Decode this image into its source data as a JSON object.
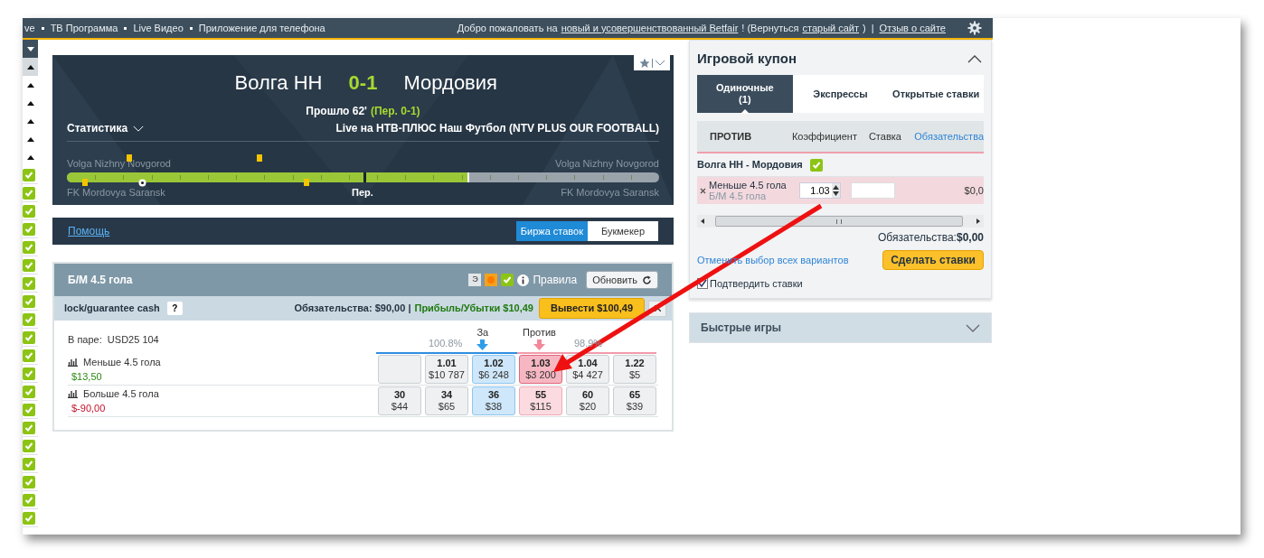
{
  "top_nav": {
    "links": [
      "ve",
      "ТВ Программа",
      "Live Видео",
      "Приложение для телефона"
    ],
    "welcome": "Добро пожаловать на",
    "new_site_link": "новый и усовершенствованный Betfair",
    "welcome_end": "! (Вернуться",
    "old_site_link": "старый сайт",
    "close_paren": ")",
    "separator": "|",
    "feedback_link": "Отзыв о сайте"
  },
  "left_column": {
    "checks": [
      {
        "checked": true
      },
      {
        "checked": true
      },
      {
        "checked": true
      },
      {
        "checked": true
      },
      {
        "checked": true
      },
      {
        "checked": true
      },
      {
        "checked": true
      },
      {
        "checked": true
      },
      {
        "checked": true
      },
      {
        "checked": true
      },
      {
        "checked": true
      },
      {
        "checked": true
      },
      {
        "checked": true
      },
      {
        "checked": true
      },
      {
        "checked": true
      },
      {
        "checked": true
      },
      {
        "checked": true
      },
      {
        "checked": true
      },
      {
        "checked": true
      },
      {
        "checked": true
      }
    ]
  },
  "scoreboard": {
    "home": "Волга НН",
    "score": "0-1",
    "away": "Мордовия",
    "elapsed": "Прошло 62'",
    "half_score": "(Пер. 0-1)",
    "stats_label": "Статистика",
    "broadcast": "Live на НТВ-ПЛЮС Наш Футбол (NTV PLUS OUR FOOTBALL)",
    "timeline": {
      "home_left": "Volga Nizhny Novgorod",
      "home_right": "Volga Nizhny Novgorod",
      "away_left": "FK Mordovya Saransk",
      "away_right": "FK Mordovya Saransk",
      "halftime": "Пер.",
      "level": 0.68,
      "home_events": [
        {
          "kind": "card",
          "level": 0.1
        },
        {
          "kind": "card",
          "level": 0.32
        }
      ],
      "away_events": [
        {
          "kind": "card",
          "level": 0.026
        },
        {
          "kind": "goal",
          "level": 0.12
        },
        {
          "kind": "card",
          "level": 0.4
        }
      ]
    }
  },
  "help_bar": {
    "help_link": "Помощь",
    "modes": [
      {
        "label": "Биржа ставок",
        "selected": true
      },
      {
        "label": "Букмекер",
        "selected": false
      }
    ]
  },
  "market": {
    "title": "Б/М 4.5 гола",
    "e_badge": "Э",
    "rules": "Правила",
    "refresh": "Обновить",
    "cashout_label": "lock/guarantee cash",
    "help": "?",
    "liability": "Обязательства: $90,00 |",
    "profit": "Прибыль/Убытки $10,49",
    "cashout_button": "Вывести $100,49",
    "matched": "В паре:  USD25 104",
    "back_percent": "100.8%",
    "back_label": "За",
    "lay_label": "Против",
    "lay_percent": "98.9%",
    "runners": [
      {
        "name": "Меньше 4.5 гола",
        "pnl": "$13,50",
        "pnl_positive": true,
        "prices": [
          {
            "kind": "empty",
            "selected": false
          },
          {
            "kind": "back",
            "odds": "1.01",
            "amount": "$10 787",
            "selected": false
          },
          {
            "kind": "best_back",
            "odds": "1.02",
            "amount": "$6 248",
            "selected": false
          },
          {
            "kind": "best_lay",
            "odds": "1.03",
            "amount": "$3 200",
            "selected": true
          },
          {
            "kind": "lay",
            "odds": "1.04",
            "amount": "$4 427",
            "selected": false
          },
          {
            "kind": "lay",
            "odds": "1.22",
            "amount": "$5",
            "selected": false
          }
        ]
      },
      {
        "name": "Больше 4.5 гола",
        "pnl": "$-90,00",
        "pnl_positive": false,
        "prices": [
          {
            "kind": "back",
            "odds": "30",
            "amount": "$44",
            "selected": false
          },
          {
            "kind": "back",
            "odds": "34",
            "amount": "$65",
            "selected": false
          },
          {
            "kind": "best_back",
            "odds": "36",
            "amount": "$38",
            "selected": false
          },
          {
            "kind": "best_lay",
            "odds": "55",
            "amount": "$115",
            "selected": false
          },
          {
            "kind": "lay",
            "odds": "60",
            "amount": "$20",
            "selected": false
          },
          {
            "kind": "lay",
            "odds": "65",
            "amount": "$39",
            "selected": false
          }
        ]
      }
    ]
  },
  "bet_slip": {
    "title": "Игровой купон",
    "tabs": [
      {
        "label": "Одиночные",
        "count": "(1)",
        "selected": true
      },
      {
        "label": "Экспрессы",
        "selected": false
      },
      {
        "label": "Открытые ставки",
        "selected": false
      }
    ],
    "columns": [
      "ПРОТИВ",
      "Коэффициент",
      "Ставка",
      "Обязательства"
    ],
    "event": "Волга НН - Мордовия",
    "event_checked": true,
    "bet": {
      "selection": "Меньше 4.5 гола",
      "market": "Б/М 4.5 гола",
      "odds": "1.03",
      "liability": "$0,0"
    },
    "total_label": "Обязательства:",
    "total": "$0,00",
    "cancel_link": "Отменить выбор всех вариантов",
    "place_button": "Сделать ставки",
    "confirm_label": "Подтвердить ставки",
    "confirm_checked": true
  },
  "quick_games": {
    "title": "Быстрые игры",
    "expanded": false
  }
}
